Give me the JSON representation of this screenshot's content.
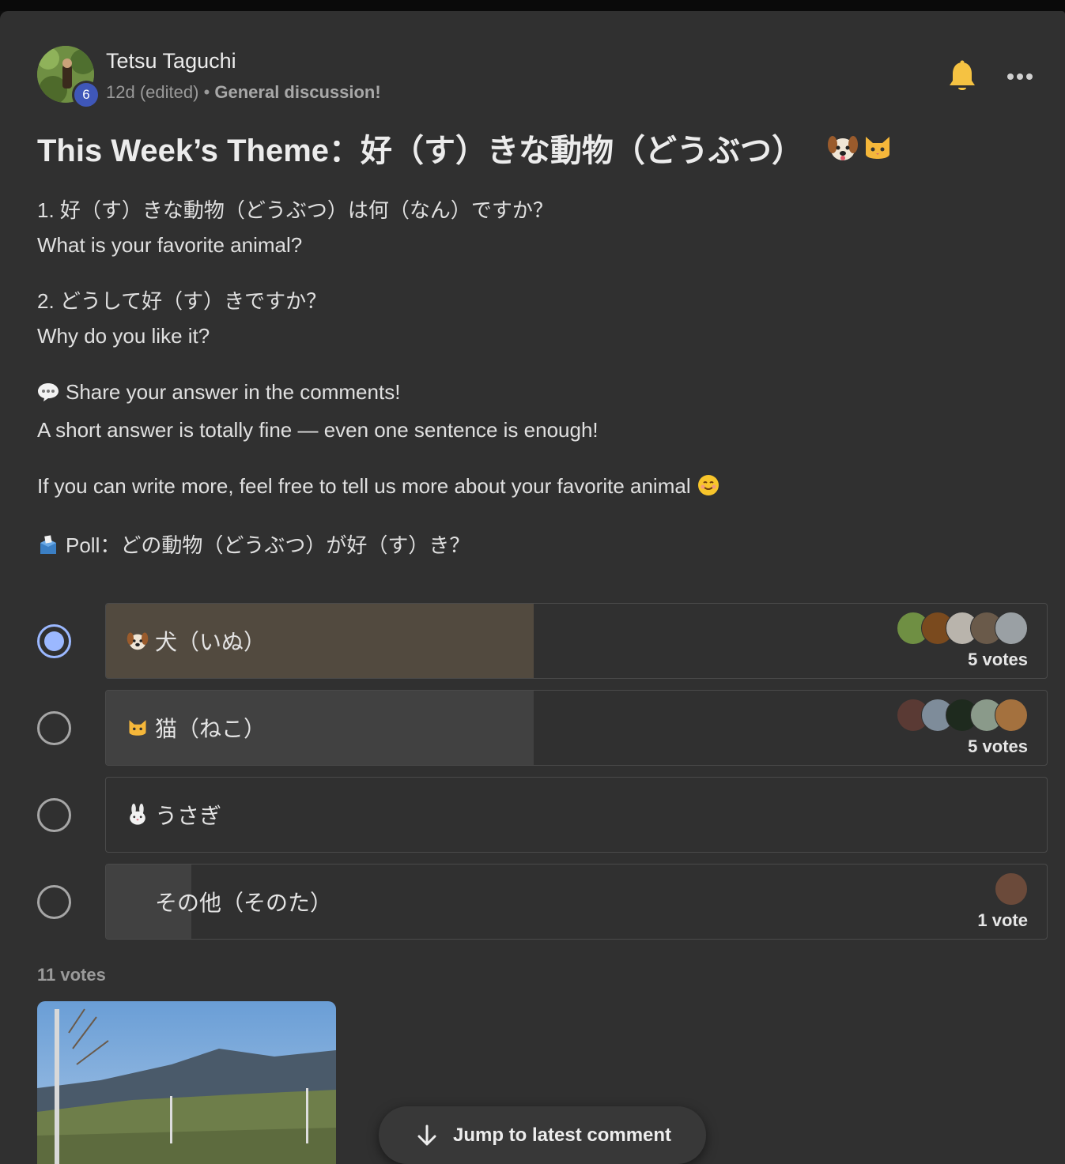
{
  "post": {
    "author": "Tetsu Taguchi",
    "level": "6",
    "time": "12d",
    "edited": "(edited)",
    "separator": "•",
    "category": "General discussion!",
    "title": "This Week’s Theme：好（す）きな動物（どうぶつ）",
    "title_icons": [
      "dog-face-icon",
      "cat-face-icon"
    ]
  },
  "body": {
    "q1_jp": "1. 好（す）きな動物（どうぶつ）は何（なん）ですか？",
    "q1_en": "What is your favorite animal?",
    "q2_jp": "2. どうして好（す）きですか？",
    "q2_en": "Why do you like it?",
    "share": "Share your answer in the comments!",
    "short": "A short answer is totally fine — even one sentence is enough!",
    "more": "If you can write more, feel free to tell us more about your favorite animal",
    "poll_heading": "Poll：どの動物（どうぶつ）が好（す）き？"
  },
  "poll": {
    "options": [
      {
        "label": "犬（いぬ）",
        "icon": "dog-face-icon",
        "votes_label": "5 votes",
        "votes": 5,
        "selected": true,
        "share": 0.455
      },
      {
        "label": "猫（ねこ）",
        "icon": "cat-face-icon",
        "votes_label": "5 votes",
        "votes": 5,
        "selected": false,
        "share": 0.455
      },
      {
        "label": "うさぎ",
        "icon": "rabbit-face-icon",
        "votes_label": "",
        "votes": 0,
        "selected": false,
        "share": 0
      },
      {
        "label": "その他（そのた）",
        "icon": "",
        "votes_label": "1 vote",
        "votes": 1,
        "selected": false,
        "share": 0.091
      }
    ],
    "total": "11 votes"
  },
  "colors": {
    "card_bg": "#303030",
    "selected_fill": "#524a3f",
    "unselected_fill": "#414141",
    "radio_selected": "#9bb8ff",
    "level_badge": "#3f57b8",
    "bell": "#f5c242"
  },
  "jump": {
    "label": "Jump to latest comment"
  }
}
